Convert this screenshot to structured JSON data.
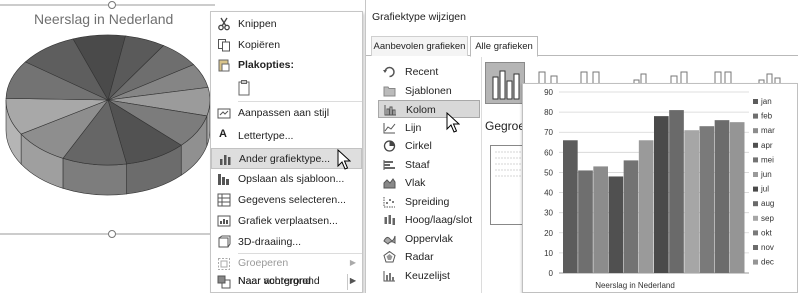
{
  "pie_chart": {
    "title": "Neerslag in Nederland"
  },
  "context_menu": {
    "items": [
      {
        "label": "Knippen",
        "icon": "scissors-icon",
        "enabled": true
      },
      {
        "label": "Kopiëren",
        "icon": "copy-icon",
        "enabled": true
      },
      {
        "label": "Plakopties:",
        "icon": "paste-icon",
        "enabled": true,
        "bold": true
      },
      {
        "label": "",
        "icon": "paste-option-icon",
        "enabled": true
      },
      {
        "label": "Aanpassen aan stijl",
        "icon": "reset-style-icon",
        "enabled": true
      },
      {
        "label": "Lettertype...",
        "icon": "font-icon",
        "enabled": true
      },
      {
        "label": "Ander grafiektype...",
        "icon": "change-chart-type-icon",
        "enabled": true,
        "highlighted": true
      },
      {
        "label": "Opslaan als sjabloon...",
        "icon": "save-template-icon",
        "enabled": true
      },
      {
        "label": "Gegevens selecteren...",
        "icon": "select-data-icon",
        "enabled": true
      },
      {
        "label": "Grafiek verplaatsen...",
        "icon": "move-chart-icon",
        "enabled": true
      },
      {
        "label": "3D-draaiing...",
        "icon": "rotation-3d-icon",
        "enabled": true
      },
      {
        "label": "Groeperen",
        "icon": "group-icon",
        "enabled": false,
        "submenu": true
      },
      {
        "label": "Naar voorgrond",
        "icon": "bring-forward-icon",
        "enabled": true,
        "submenu": true
      },
      {
        "label": "Naar achtergrond",
        "icon": "send-backward-icon",
        "enabled": true,
        "submenu": true
      }
    ]
  },
  "dialog": {
    "title": "Grafiektype wijzigen",
    "tabs": [
      {
        "label": "Aanbevolen grafieken",
        "active": false
      },
      {
        "label": "Alle grafieken",
        "active": true
      }
    ],
    "chart_types": [
      {
        "label": "Recent",
        "icon": "recent-icon"
      },
      {
        "label": "Sjablonen",
        "icon": "folder-icon"
      },
      {
        "label": "Kolom",
        "icon": "column-chart-icon",
        "selected": true
      },
      {
        "label": "Lijn",
        "icon": "line-chart-icon"
      },
      {
        "label": "Cirkel",
        "icon": "pie-chart-icon"
      },
      {
        "label": "Staaf",
        "icon": "bar-chart-icon"
      },
      {
        "label": "Vlak",
        "icon": "area-chart-icon"
      },
      {
        "label": "Spreiding",
        "icon": "scatter-chart-icon"
      },
      {
        "label": "Hoog/laag/slot",
        "icon": "stock-chart-icon"
      },
      {
        "label": "Oppervlak",
        "icon": "surface-chart-icon"
      },
      {
        "label": "Radar",
        "icon": "radar-chart-icon"
      },
      {
        "label": "Keuzelijst",
        "icon": "combo-chart-icon"
      }
    ],
    "subtype_heading": "Gegroe"
  },
  "chart_data": {
    "type": "bar",
    "title": "",
    "xlabel": "Neerslag in Nederland",
    "ylabel": "",
    "ylim": [
      0,
      90
    ],
    "yticks": [
      0,
      10,
      20,
      30,
      40,
      50,
      60,
      70,
      80,
      90
    ],
    "grid": true,
    "legend_position": "right",
    "series": [
      {
        "name": "jan",
        "values": [
          66
        ]
      },
      {
        "name": "feb",
        "values": [
          51
        ]
      },
      {
        "name": "mar",
        "values": [
          53
        ]
      },
      {
        "name": "apr",
        "values": [
          48
        ]
      },
      {
        "name": "mei",
        "values": [
          56
        ]
      },
      {
        "name": "jun",
        "values": [
          66
        ]
      },
      {
        "name": "jul",
        "values": [
          78
        ]
      },
      {
        "name": "aug",
        "values": [
          81
        ]
      },
      {
        "name": "sep",
        "values": [
          71
        ]
      },
      {
        "name": "okt",
        "values": [
          73
        ]
      },
      {
        "name": "nov",
        "values": [
          76
        ]
      },
      {
        "name": "dec",
        "values": [
          75
        ]
      }
    ],
    "colors": [
      "#5c5c5c",
      "#6f6f6f",
      "#8c8c8c",
      "#505050",
      "#737373",
      "#9a9a9a",
      "#4a4a4a",
      "#6a6a6a",
      "#a6a6a6",
      "#7a7a7a",
      "#6c6c6c",
      "#959595"
    ]
  }
}
